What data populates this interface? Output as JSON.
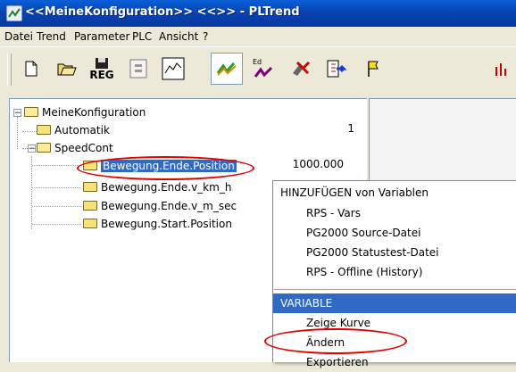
{
  "window": {
    "title": "<<MeineKonfiguration>> <<>> - PLTrend"
  },
  "menu": [
    "Datei",
    "Trend",
    "Parameter",
    "PLC",
    "Ansicht",
    "?"
  ],
  "toolbar": {
    "reg_label": "REG",
    "ed_label": "Ed",
    "buttons": [
      "new-file",
      "open-folder",
      "save-reg",
      "module",
      "chart-window",
      "trend-green",
      "edit-trend",
      "plug-disconnect",
      "export",
      "flag",
      "more"
    ]
  },
  "tree": {
    "root": "MeineKonfiguration",
    "items": [
      {
        "label": "Automatik",
        "value": "1"
      },
      {
        "label": "SpeedCont",
        "value": ""
      },
      {
        "label": "Bewegung.Ende.Position",
        "value": "1000.000"
      },
      {
        "label": "Bewegung.Ende.v_km_h",
        "value": ""
      },
      {
        "label": "Bewegung.Ende.v_m_sec",
        "value": ""
      },
      {
        "label": "Bewegung.Start.Position",
        "value": ""
      }
    ]
  },
  "context_menu": {
    "header_add": "HINZUFÜGEN von Variablen",
    "add_items": [
      "RPS - Vars",
      "PG2000 Source-Datei",
      "PG2000 Statustest-Datei",
      "RPS - Offline (History)"
    ],
    "header_variable": "VARIABLE",
    "variable_items": [
      "Zeige Kurve",
      "Ändern",
      "Exportieren"
    ]
  },
  "colors": {
    "selection": "#316ac5",
    "highlight_ring": "#e00000",
    "titlebar": "#0844b3"
  }
}
